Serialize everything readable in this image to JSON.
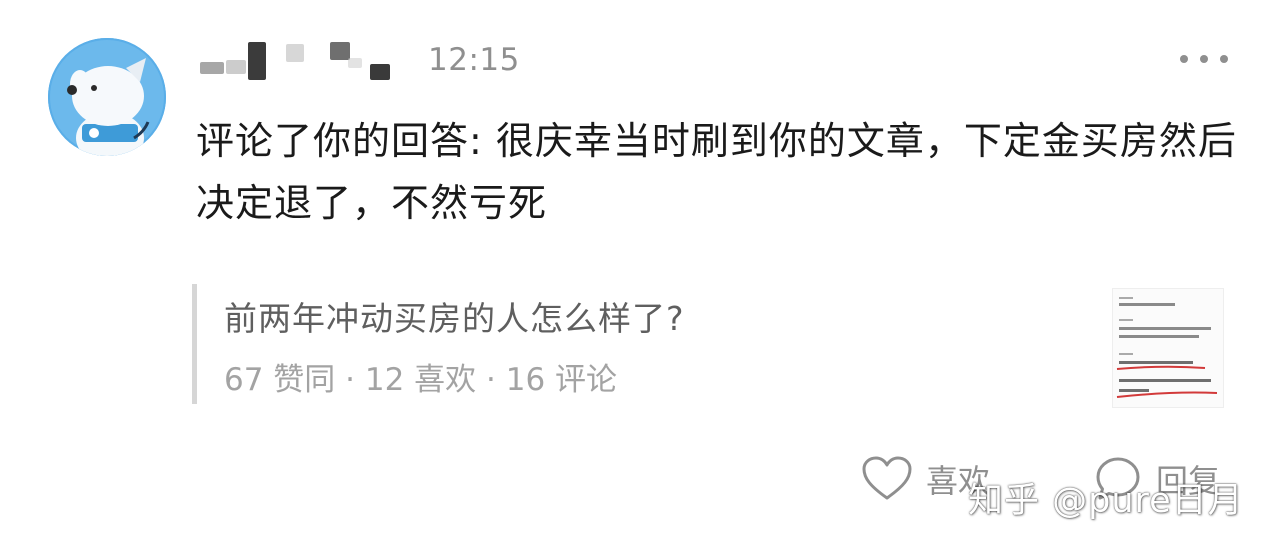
{
  "comment_card": {
    "user": {
      "avatar_icon": "polar-bear-mascot-avatar"
    },
    "time": "12:15",
    "more_icon": "more-dots-icon",
    "comment_text": "评论了你的回答: 很庆幸当时刷到你的文章，下定金买房然后决定退了，不然亏死",
    "quoted_answer": {
      "question_title": "前两年冲动买房的人怎么样了?",
      "stats": "67 赞同 · 12 喜欢 · 16 评论"
    },
    "actions": {
      "like_label": "喜欢",
      "reply_label": "回复"
    }
  },
  "watermark": "知乎 @pure日月",
  "colors": {
    "text_primary": "#1a1a1a",
    "text_secondary": "#8f8f8f",
    "quote_bar": "#d6d6d6",
    "avatar_bg": "#5aaee8"
  }
}
